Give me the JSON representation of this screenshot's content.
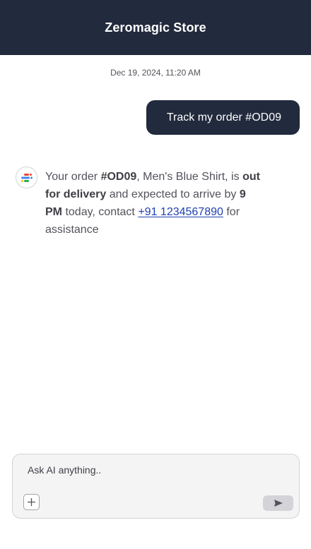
{
  "header": {
    "title": "Zeromagic Store"
  },
  "chat": {
    "timestamp": "Dec 19, 2024, 11:20 AM",
    "user_message": "Track my order #OD09",
    "bot_message": {
      "part1": "Your order ",
      "order_id": "#OD09",
      "part2": ", Men's Blue Shirt, is ",
      "status": "out for delivery",
      "part3": " and expected to arrive by ",
      "time": "9 PM",
      "part4": " today, contact ",
      "phone": "+91 1234567890",
      "part5": " for assistance"
    }
  },
  "composer": {
    "placeholder": "Ask AI anything..",
    "value": ""
  },
  "icons": {
    "avatar": "bot-logo-icon",
    "add": "plus-icon",
    "send": "send-icon"
  },
  "colors": {
    "header_bg": "#222a3d",
    "user_bubble_bg": "#222a3d",
    "link": "#1e40af",
    "logo_red": "#ea4335",
    "logo_blue": "#4285f4",
    "logo_yellow": "#fbbc05",
    "logo_green": "#34a853"
  }
}
